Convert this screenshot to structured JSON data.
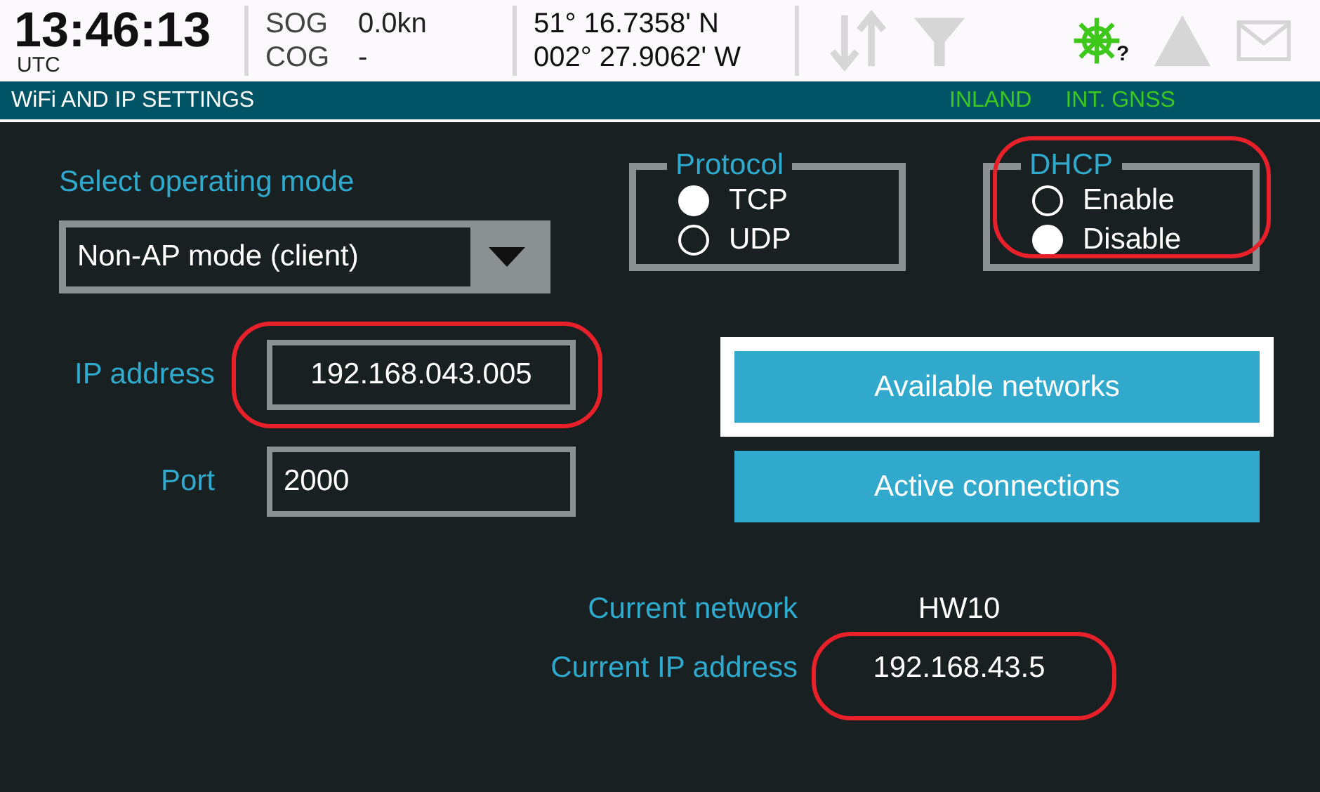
{
  "status_bar": {
    "time": "13:46:13",
    "timezone": "UTC",
    "sog_label": "SOG",
    "sog_value": "0.0kn",
    "cog_label": "COG",
    "cog_value": "-",
    "latitude": "51° 16.7358' N",
    "longitude": "002° 27.9062' W",
    "wheel_badge": "?"
  },
  "title_bar": {
    "title": "WiFi AND IP SETTINGS",
    "indicators": [
      "INLAND",
      "INT. GNSS"
    ]
  },
  "mode": {
    "label": "Select operating mode",
    "value": "Non-AP mode (client)"
  },
  "protocol": {
    "legend": "Protocol",
    "highlighted": false,
    "options": [
      {
        "label": "TCP",
        "selected": true
      },
      {
        "label": "UDP",
        "selected": false
      }
    ]
  },
  "dhcp": {
    "legend": "DHCP",
    "highlighted": true,
    "options": [
      {
        "label": "Enable",
        "selected": false
      },
      {
        "label": "Disable",
        "selected": true
      }
    ]
  },
  "fields": [
    {
      "label": "IP address",
      "value": "192.168.043.005",
      "highlighted": true
    },
    {
      "label": "Port",
      "value": "2000",
      "highlighted": false
    }
  ],
  "buttons": [
    {
      "label": "Available networks",
      "focused": true
    },
    {
      "label": "Active connections",
      "focused": false
    }
  ],
  "current": [
    {
      "label": "Current network",
      "value": "HW10",
      "highlighted": false
    },
    {
      "label": "Current IP address",
      "value": "192.168.43.5",
      "highlighted": true
    }
  ]
}
